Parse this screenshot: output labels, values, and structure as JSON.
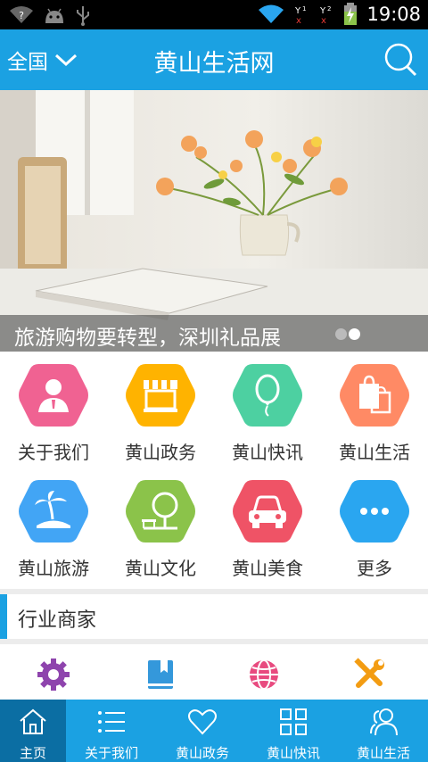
{
  "status_bar": {
    "time": "19:08"
  },
  "header": {
    "region": "全国",
    "title": "黄山生活网"
  },
  "banner": {
    "caption": "旅游购物要转型，深圳礼品展",
    "dot_count": 2,
    "active_dot": 1
  },
  "grid": [
    {
      "label": "关于我们",
      "color": "#f06292",
      "icon": "person-icon"
    },
    {
      "label": "黄山政务",
      "color": "#ffb300",
      "icon": "storefront-icon"
    },
    {
      "label": "黄山快讯",
      "color": "#4dd0a1",
      "icon": "balloon-icon"
    },
    {
      "label": "黄山生活",
      "color": "#ff8a65",
      "icon": "shopping-bags-icon"
    },
    {
      "label": "黄山旅游",
      "color": "#42a5f5",
      "icon": "palm-island-icon"
    },
    {
      "label": "黄山文化",
      "color": "#8bc34a",
      "icon": "tree-bench-icon"
    },
    {
      "label": "黄山美食",
      "color": "#ef5366",
      "icon": "car-icon"
    },
    {
      "label": "更多",
      "color": "#2aa6f0",
      "icon": "more-dots-icon"
    }
  ],
  "section": {
    "title": "行业商家"
  },
  "tools": [
    {
      "icon": "gear-icon",
      "color": "#8e44ad"
    },
    {
      "icon": "book-icon",
      "color": "#3498db"
    },
    {
      "icon": "globe-icon",
      "color": "#e84a7f"
    },
    {
      "icon": "wrench-screwdriver-icon",
      "color": "#f39c12"
    }
  ],
  "bottom_nav": [
    {
      "label": "主页",
      "icon": "home-icon",
      "active": true
    },
    {
      "label": "关于我们",
      "icon": "list-icon",
      "active": false
    },
    {
      "label": "黄山政务",
      "icon": "heart-icon",
      "active": false
    },
    {
      "label": "黄山快讯",
      "icon": "grid-icon",
      "active": false
    },
    {
      "label": "黄山生活",
      "icon": "users-icon",
      "active": false
    }
  ],
  "colors": {
    "primary": "#1ba1e2",
    "nav_active": "#0b6ea3"
  }
}
